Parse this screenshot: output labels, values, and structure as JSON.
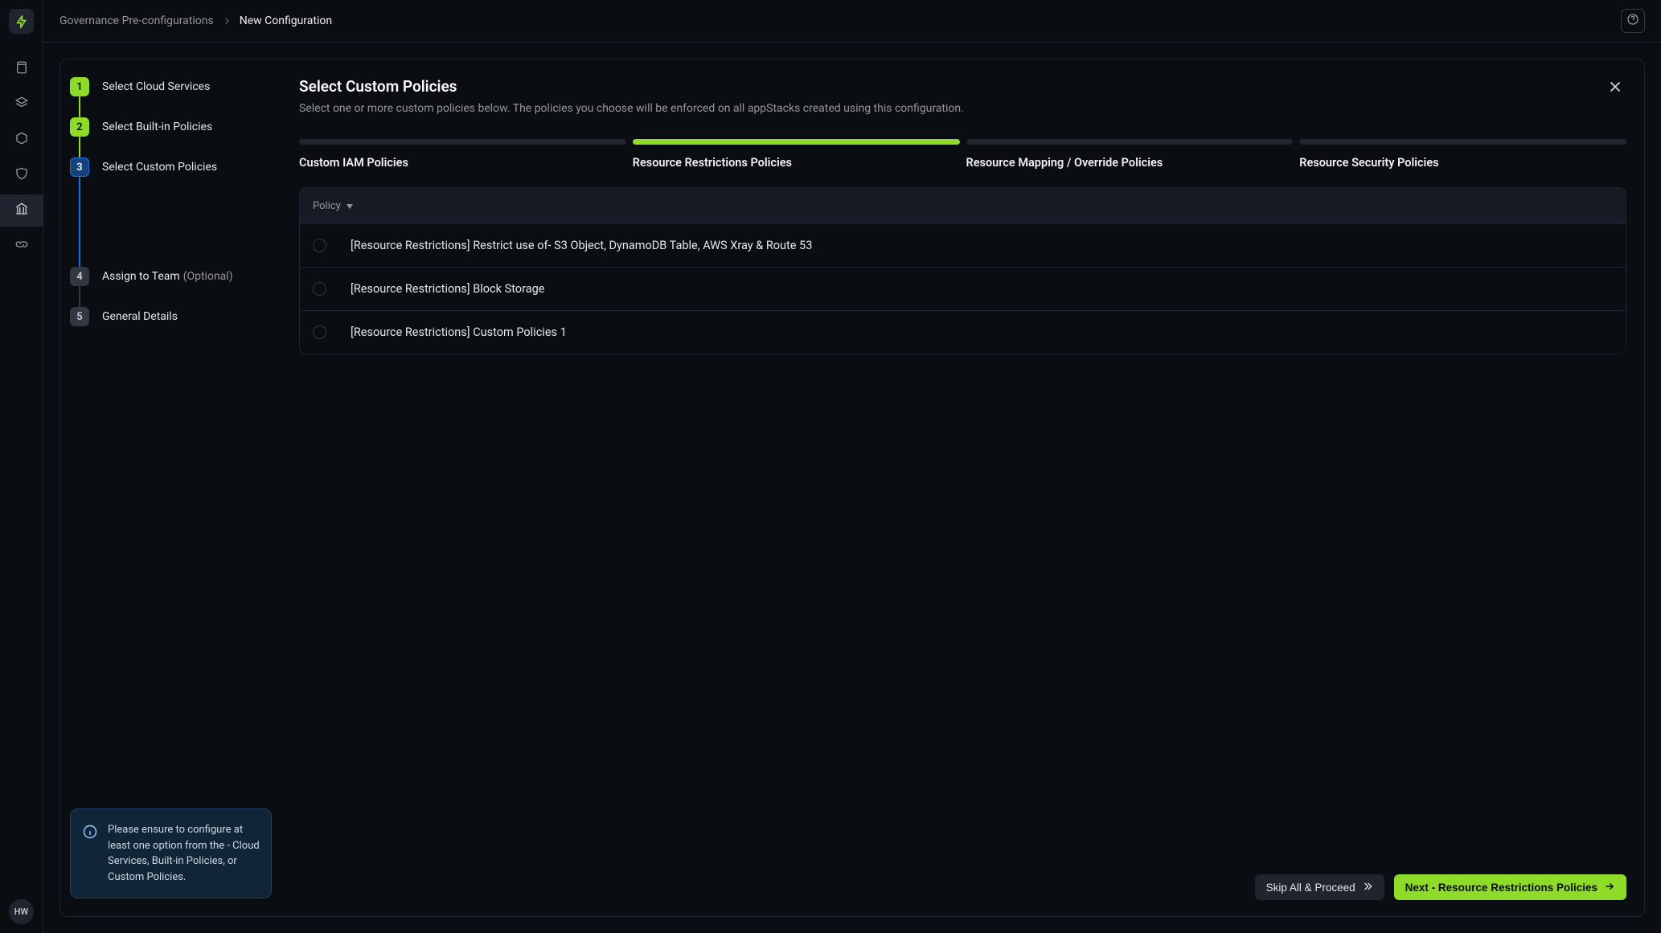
{
  "rail": {
    "avatar": "HW"
  },
  "breadcrumbs": {
    "items": [
      {
        "label": "Governance Pre-configurations"
      },
      {
        "label": "New Configuration"
      }
    ]
  },
  "stepper": {
    "steps": [
      {
        "num": "1",
        "label": "Select Cloud Services"
      },
      {
        "num": "2",
        "label": "Select Built-in Policies"
      },
      {
        "num": "3",
        "label": "Select Custom Policies"
      },
      {
        "num": "4",
        "label": "Assign to Team",
        "opt": "(Optional)"
      },
      {
        "num": "5",
        "label": "General Details"
      }
    ],
    "info": "Please ensure to configure at least one option from the - Cloud Services, Built-in Policies, or Custom Policies."
  },
  "right": {
    "title": "Select Custom Policies",
    "subtitle": "Select one or more custom policies below. The policies you choose will be enforced on all appStacks created using this configuration.",
    "tabs": [
      {
        "label": "Custom IAM Policies"
      },
      {
        "label": "Resource Restrictions Policies"
      },
      {
        "label": "Resource Mapping / Override Policies"
      },
      {
        "label": "Resource Security Policies"
      }
    ],
    "table": {
      "header": "Policy",
      "rows": [
        {
          "label": "[Resource Restrictions] Restrict use of- S3 Object, DynamoDB Table, AWS Xray & Route 53"
        },
        {
          "label": "[Resource Restrictions] Block Storage"
        },
        {
          "label": "[Resource Restrictions] Custom Policies 1"
        }
      ]
    },
    "footer": {
      "skip": "Skip All & Proceed",
      "next": "Next - Resource Restrictions Policies"
    }
  }
}
